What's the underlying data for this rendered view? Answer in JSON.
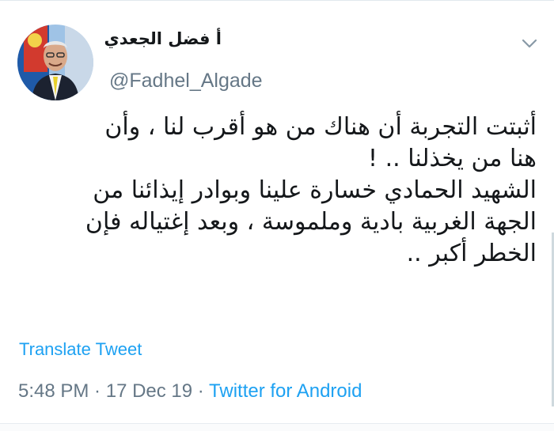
{
  "tweet": {
    "author": {
      "display_name": "أ فضل الجعدي",
      "handle": "@Fadhel_Algade",
      "avatar": "profile-photo"
    },
    "text_lines": [
      "أثبتت التجربة أن هناك من هو أقرب لنا ، وأن",
      "هنا من يخذلنا .. !",
      "الشهيد الحمادي خسارة علينا وبوادر إيذائنا من",
      "الجهة الغربية بادية وملموسة ، وبعد إغتياله فإن",
      "الخطر أكبر .."
    ],
    "translate_label": "Translate Tweet",
    "time": "5:48 PM",
    "date": "17 Dec 19",
    "separator": " · ",
    "source": "Twitter for Android",
    "menu_icon": "chevron-down-icon"
  },
  "colors": {
    "accent": "#1da1f2",
    "text": "#14171a",
    "secondary": "#657786"
  }
}
